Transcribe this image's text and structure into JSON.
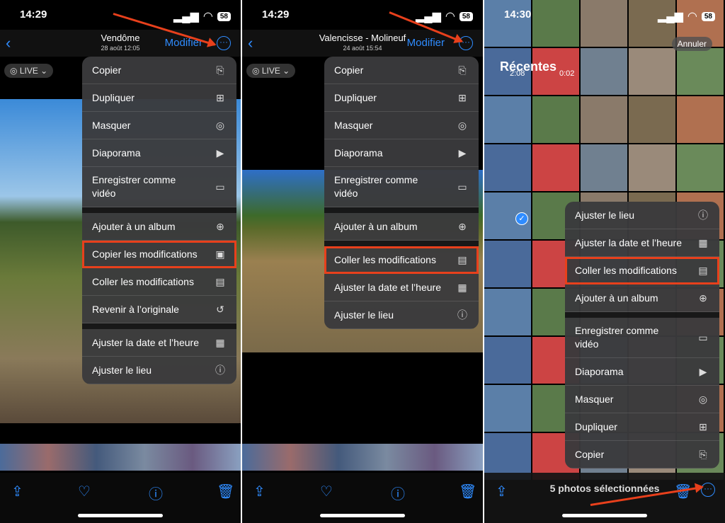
{
  "colors": {
    "accent": "#2f8cff",
    "highlight": "#e8401c"
  },
  "panel1": {
    "time": "14:29",
    "battery": "58",
    "title": "Vendôme",
    "subtitle": "28 août  12:05",
    "edit": "Modifier",
    "live": "LIVE",
    "menu": [
      {
        "label": "Copier",
        "icon": "copy-icon",
        "glyph": "⎘"
      },
      {
        "label": "Dupliquer",
        "icon": "duplicate-icon",
        "glyph": "⊞"
      },
      {
        "label": "Masquer",
        "icon": "hide-icon",
        "glyph": "◎"
      },
      {
        "label": "Diaporama",
        "icon": "slideshow-icon",
        "glyph": "▶"
      },
      {
        "label": "Enregistrer comme vidéo",
        "icon": "video-icon",
        "glyph": "▭"
      },
      {
        "label": "Ajouter à un album",
        "icon": "album-icon",
        "glyph": "⊕"
      },
      {
        "label": "Copier les modifications",
        "icon": "copy-edits-icon",
        "glyph": "▣"
      },
      {
        "label": "Coller les modifications",
        "icon": "paste-edits-icon",
        "glyph": "▤"
      },
      {
        "label": "Revenir à l’originale",
        "icon": "revert-icon",
        "glyph": "↺"
      },
      {
        "label": "Ajuster la date et l’heure",
        "icon": "calendar-icon",
        "glyph": "▦"
      },
      {
        "label": "Ajuster le lieu",
        "icon": "location-icon",
        "glyph": "ⓘ"
      }
    ]
  },
  "panel2": {
    "time": "14:29",
    "battery": "58",
    "title": "Valencisse - Molineuf",
    "subtitle": "24 août  15:54",
    "edit": "Modifier",
    "live": "LIVE",
    "menu": [
      {
        "label": "Copier",
        "icon": "copy-icon",
        "glyph": "⎘"
      },
      {
        "label": "Dupliquer",
        "icon": "duplicate-icon",
        "glyph": "⊞"
      },
      {
        "label": "Masquer",
        "icon": "hide-icon",
        "glyph": "◎"
      },
      {
        "label": "Diaporama",
        "icon": "slideshow-icon",
        "glyph": "▶"
      },
      {
        "label": "Enregistrer comme vidéo",
        "icon": "video-icon",
        "glyph": "▭"
      },
      {
        "label": "Ajouter à un album",
        "icon": "album-icon",
        "glyph": "⊕"
      },
      {
        "label": "Coller les modifications",
        "icon": "paste-edits-icon",
        "glyph": "▤"
      },
      {
        "label": "Ajuster la date et l’heure",
        "icon": "calendar-icon",
        "glyph": "▦"
      },
      {
        "label": "Ajuster le lieu",
        "icon": "location-icon",
        "glyph": "ⓘ"
      }
    ]
  },
  "panel3": {
    "time": "14:30",
    "battery": "58",
    "title": "Récentes",
    "cancel": "Annuler",
    "durations": [
      "2:08",
      "0:02"
    ],
    "selected_count": "5 photos sélectionnées",
    "menu": [
      {
        "label": "Ajuster le lieu",
        "icon": "location-icon",
        "glyph": "ⓘ"
      },
      {
        "label": "Ajuster la date et l’heure",
        "icon": "calendar-icon",
        "glyph": "▦"
      },
      {
        "label": "Coller les modifications",
        "icon": "paste-edits-icon",
        "glyph": "▤"
      },
      {
        "label": "Ajouter à un album",
        "icon": "album-icon",
        "glyph": "⊕"
      },
      {
        "label": "Enregistrer comme vidéo",
        "icon": "video-icon",
        "glyph": "▭"
      },
      {
        "label": "Diaporama",
        "icon": "slideshow-icon",
        "glyph": "▶"
      },
      {
        "label": "Masquer",
        "icon": "hide-icon",
        "glyph": "◎"
      },
      {
        "label": "Dupliquer",
        "icon": "duplicate-icon",
        "glyph": "⊞"
      },
      {
        "label": "Copier",
        "icon": "copy-icon",
        "glyph": "⎘"
      }
    ]
  }
}
